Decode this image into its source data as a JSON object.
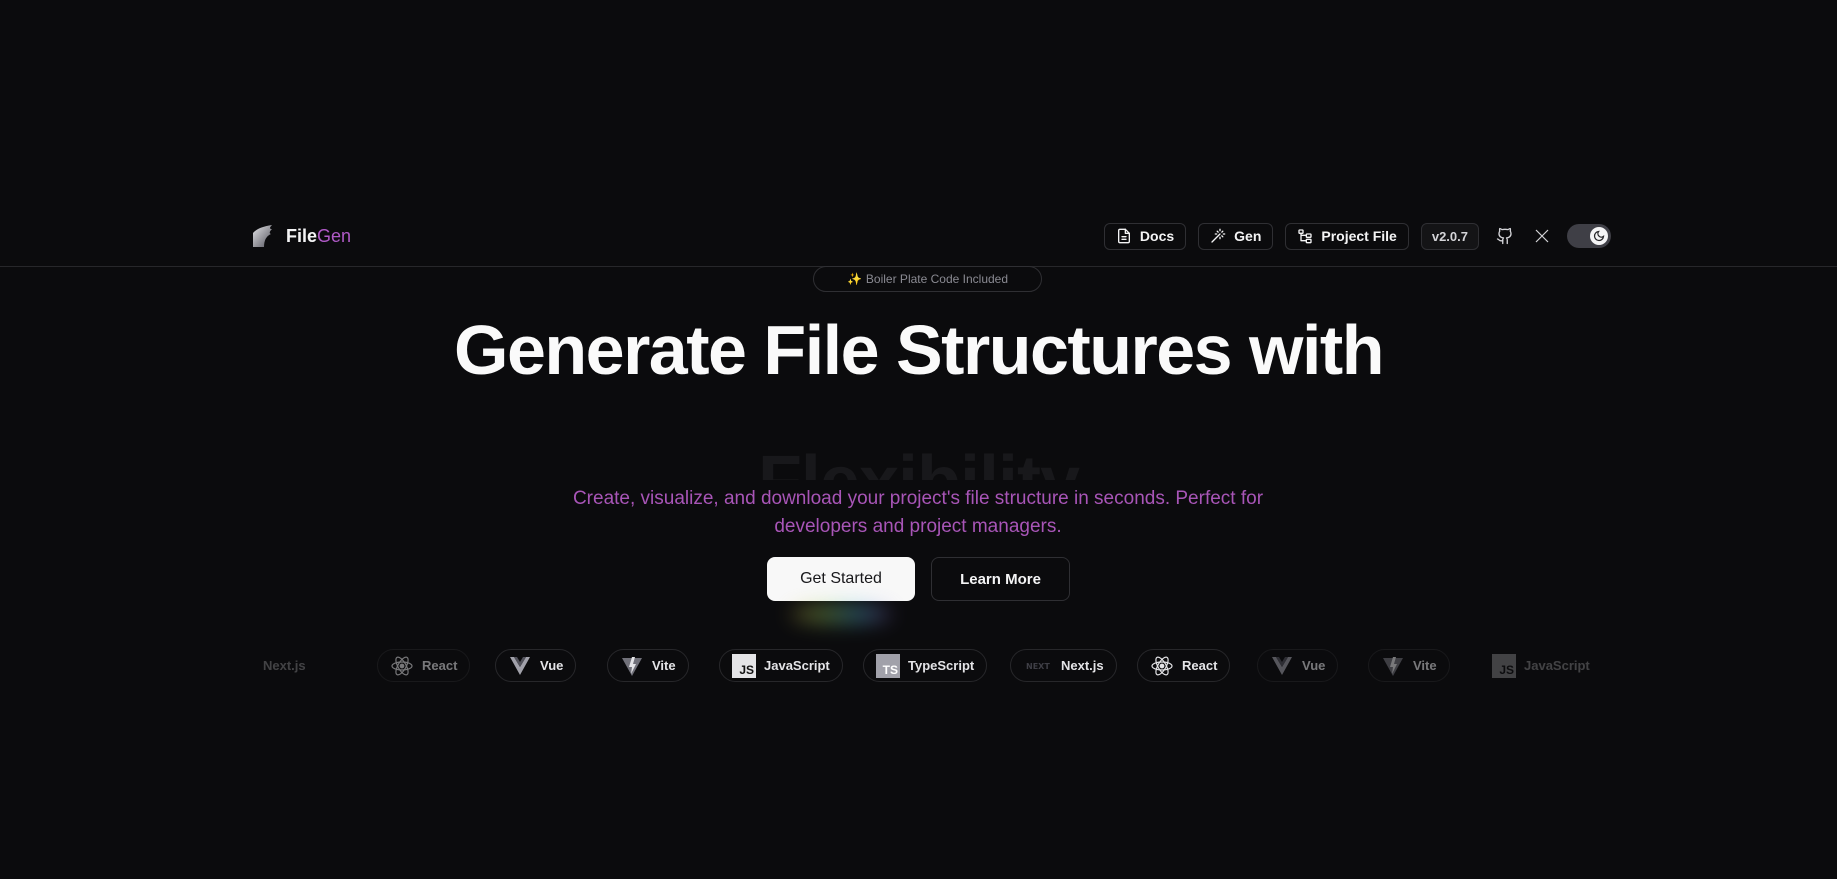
{
  "header": {
    "logo": {
      "brand_main": "File",
      "brand_accent": "Gen"
    },
    "nav": {
      "docs_label": "Docs",
      "gen_label": "Gen",
      "project_file_label": "Project File",
      "version": "v2.0.7"
    },
    "icons": [
      "file-text-icon",
      "wand-icon",
      "folder-tree-icon",
      "github-icon",
      "x-logo-icon",
      "moon-icon"
    ],
    "theme": "dark"
  },
  "badge": {
    "icon": "✨",
    "text": "Boiler Plate Code Included"
  },
  "hero": {
    "title": "Generate File Structures with",
    "subtitle_partial": "Flexibility",
    "description": "Create, visualize, and download your project's file structure in seconds. Perfect for developers and project managers."
  },
  "cta": {
    "primary": "Get Started",
    "secondary": "Learn More"
  },
  "tech": {
    "nextjs": "Next.js",
    "react": "React",
    "vue": "Vue",
    "vite": "Vite",
    "javascript": "JavaScript",
    "typescript": "TypeScript",
    "js_badge": "JS",
    "ts_badge": "TS"
  },
  "colors": {
    "background": "#0b0b0d",
    "accent": "#b05ac7",
    "description": "#a855b7",
    "border": "#2f2f33"
  }
}
